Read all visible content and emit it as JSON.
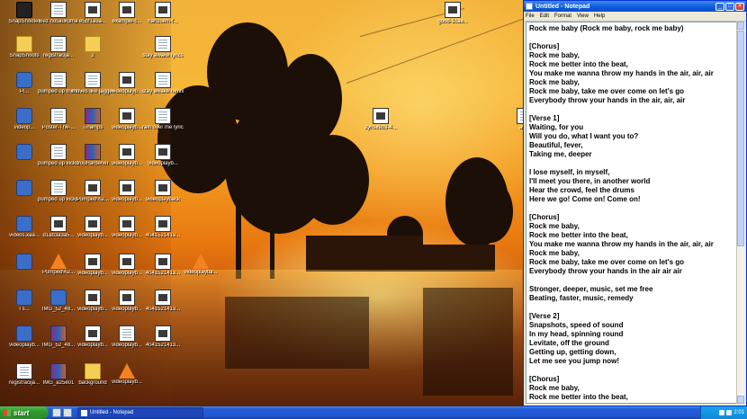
{
  "desktop": {
    "icons": [
      {
        "label": "SnapShooter",
        "type": "cam"
      },
      {
        "label": "Bez nosaukuma",
        "type": "doc"
      },
      {
        "label": "e5bf1a3a...",
        "type": "video"
      },
      {
        "label": "example-c...",
        "type": "video"
      },
      {
        "label": "hanzoem-f...",
        "type": "video"
      },
      {
        "label": "good-1caa...",
        "type": "video"
      },
      {
        "label": "SnapShoots",
        "type": "folder"
      },
      {
        "label": "registracija...",
        "type": "doc"
      },
      {
        "label": "2",
        "type": "folder"
      },
      {
        "label": "stay awake lyrics",
        "type": "doc"
      },
      {
        "label": "Pi...",
        "type": "app"
      },
      {
        "label": "pumped up the kicks",
        "type": "doc"
      },
      {
        "label": "moves like jagger lyrics",
        "type": "doc"
      },
      {
        "label": "videoplayb...",
        "type": "video"
      },
      {
        "label": "stay awake remix lyrics",
        "type": "doc"
      },
      {
        "label": "videop...",
        "type": "app"
      },
      {
        "label": "Poster-The-...",
        "type": "doc"
      },
      {
        "label": "Tinamps",
        "type": "rar"
      },
      {
        "label": "videoplayb...",
        "type": "video"
      },
      {
        "label": "rain over me lyrics",
        "type": "doc"
      },
      {
        "label": "zynsx9b3-4...",
        "type": "video"
      },
      {
        "label": "aw...",
        "type": "doc"
      },
      {
        "label": "",
        "type": "app"
      },
      {
        "label": "pumped up kicks lyrics",
        "type": "doc"
      },
      {
        "label": "YouHardener",
        "type": "rar"
      },
      {
        "label": "videoplayb...",
        "type": "video"
      },
      {
        "label": "videoplayb...",
        "type": "video"
      },
      {
        "label": "",
        "type": "app"
      },
      {
        "label": "pumped up kicks lyrics",
        "type": "doc"
      },
      {
        "label": "Pumped%2...",
        "type": "video"
      },
      {
        "label": "videoplayb...",
        "type": "video"
      },
      {
        "label": "videoplayback",
        "type": "video"
      },
      {
        "label": "videos.xaa...",
        "type": "app"
      },
      {
        "label": "d1ab3a3a5...",
        "type": "video"
      },
      {
        "label": "videoplayb...",
        "type": "video"
      },
      {
        "label": "videoplayb...",
        "type": "video"
      },
      {
        "label": "4041521413...",
        "type": "video"
      },
      {
        "label": "",
        "type": "app"
      },
      {
        "label": "Pumped%2...",
        "type": "vlc"
      },
      {
        "label": "videoplayb...",
        "type": "video"
      },
      {
        "label": "videoplayb...",
        "type": "video"
      },
      {
        "label": "4041521413...",
        "type": "video"
      },
      {
        "label": "videoplayba...",
        "type": "vlc"
      },
      {
        "label": "I s...",
        "type": "app"
      },
      {
        "label": "IMG_52_48...",
        "type": "app"
      },
      {
        "label": "videoplayb...",
        "type": "video"
      },
      {
        "label": "videoplayb...",
        "type": "video"
      },
      {
        "label": "4041521413...",
        "type": "video"
      },
      {
        "label": "videoplayb...",
        "type": "app"
      },
      {
        "label": "IMG_52_48...",
        "type": "rar"
      },
      {
        "label": "videoplayb...",
        "type": "video"
      },
      {
        "label": "videoplayb...",
        "type": "doc"
      },
      {
        "label": "4041521413...",
        "type": "video"
      },
      {
        "label": "registracija...",
        "type": "doc"
      },
      {
        "label": "IMG_a25e01",
        "type": "rar"
      },
      {
        "label": "background",
        "type": "folder"
      },
      {
        "label": "videoplayb...",
        "type": "vlc"
      }
    ]
  },
  "notepad": {
    "title": "Untitled - Notepad",
    "menu": [
      "File",
      "Edit",
      "Format",
      "View",
      "Help"
    ],
    "lines": [
      "Rock me baby (Rock me baby, rock me baby)",
      "",
      "[Chorus]",
      "Rock me baby,",
      "Rock me better into the beat,",
      "You make me wanna throw my hands in the air, air, air",
      "Rock me baby,",
      "Rock me baby, take me over come on let's go",
      "Everybody throw your hands in the air, air, air",
      "",
      "[Verse 1]",
      "Waiting, for you",
      "Will you do, what I want you to?",
      "Beautiful, fever,",
      "Taking me, deeper",
      "",
      "I lose myself, in myself,",
      "I'll meet you there, in another world",
      "Hear the crowd, feel the drums",
      "Here we go! Come on! Come on!",
      "",
      "[Chorus]",
      "Rock me baby,",
      "Rock me better into the beat,",
      "You make me wanna throw my hands in the air, air, air",
      "Rock me baby,",
      "Rock me baby, take me over come on let's go",
      "Everybody throw your hands in the air air air",
      "",
      "Stronger, deeper, music, set me free",
      "Beating, faster, music, remedy",
      "",
      "[Verse 2]",
      "Snapshots, speed of sound",
      "In my head, spinning round",
      "Levitate, off the ground",
      "Getting up, getting down,",
      "Let me see you jump now!",
      "",
      "[Chorus]",
      "Rock me baby,",
      "Rock me better into the beat,"
    ]
  },
  "taskbar": {
    "start_label": "start",
    "task_label": "Untitled - Notepad",
    "clock": "2:01"
  }
}
